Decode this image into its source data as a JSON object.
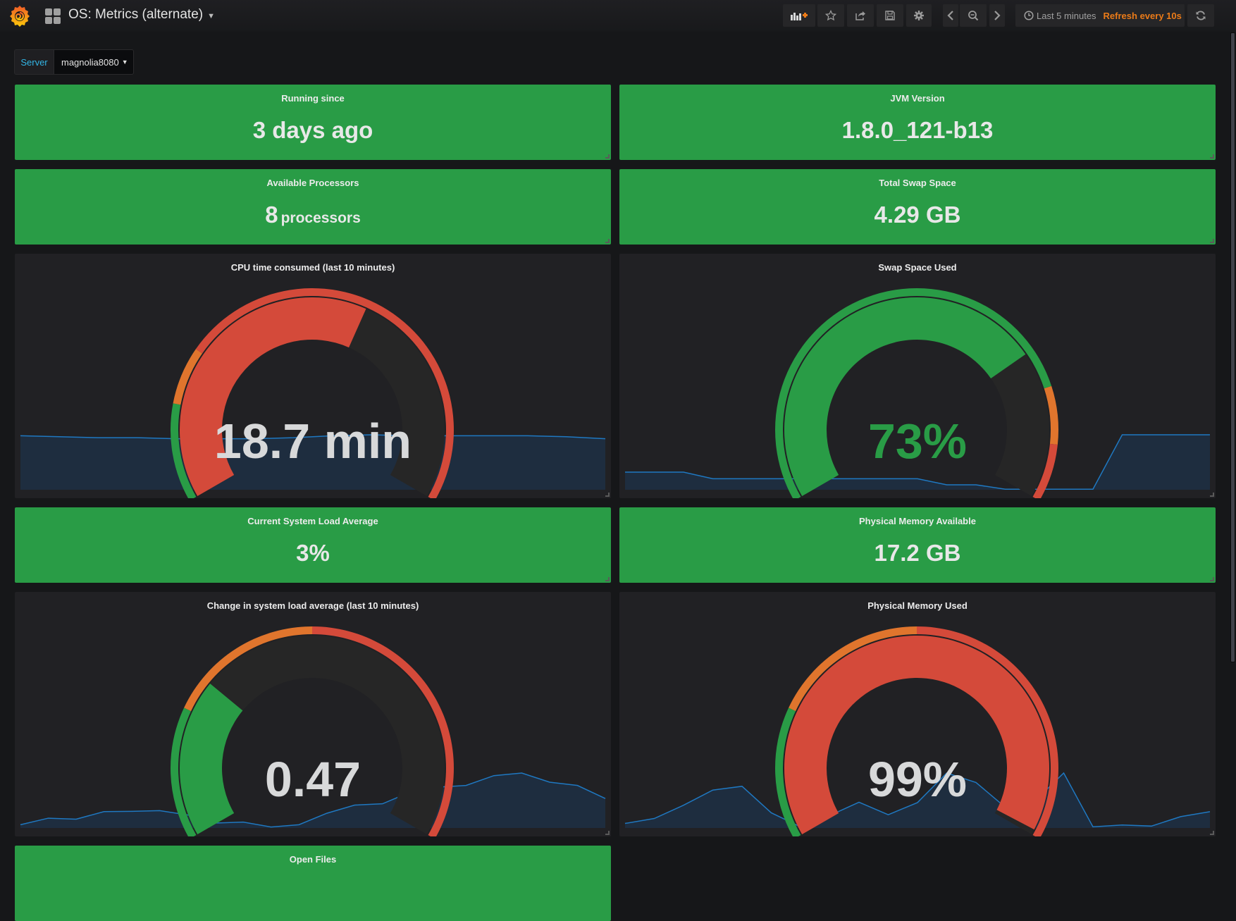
{
  "header": {
    "title": "OS: Metrics (alternate)",
    "icons": {
      "logo": "grafana-logo",
      "dashboards": "dashboard-grid-icon",
      "add_panel": "add-panel-icon",
      "star": "star-icon",
      "share": "share-icon",
      "save": "save-icon",
      "settings": "gear-icon",
      "prev": "chevron-left-icon",
      "zoom_out": "zoom-out-icon",
      "next": "chevron-right-icon",
      "clock": "clock-icon",
      "refresh": "refresh-icon"
    },
    "time_range": "Last 5 minutes",
    "refresh_label": "Refresh every 10s"
  },
  "variables": [
    {
      "label": "Server",
      "value": "magnolia8080"
    }
  ],
  "colors": {
    "ok": "#299c46",
    "warn": "#e0752d",
    "crit": "#d44a3a",
    "spark_line": "#1f78c1",
    "spark_fill": "#1e2d3f",
    "accent_orange": "#eb7b18",
    "variable_label": "#33b5e5"
  },
  "stat_panels": [
    {
      "title": "Running since",
      "value": "3 days ago",
      "unit": ""
    },
    {
      "title": "JVM Version",
      "value": "1.8.0_121-b13",
      "unit": ""
    },
    {
      "title": "Available Processors",
      "value": "8",
      "unit": "processors"
    },
    {
      "title": "Total Swap Space",
      "value": "4.29 GB",
      "unit": ""
    },
    {
      "title": "Current System Load Average",
      "value": "3%",
      "unit": ""
    },
    {
      "title": "Physical Memory Available",
      "value": "17.2 GB",
      "unit": ""
    },
    {
      "title": "Open Files",
      "value": "",
      "unit": ""
    }
  ],
  "gauge_panels": [
    {
      "title": "CPU time consumed (last 10 minutes)",
      "value": "18.7 min",
      "value_color": "#d8d9da",
      "fill_fraction": 0.6,
      "fill_color": "#d44a3a",
      "thresholds": [
        {
          "to": 0.17,
          "color": "#299c46"
        },
        {
          "to": 0.27,
          "color": "#e0752d"
        },
        {
          "to": 1.0,
          "color": "#d44a3a"
        }
      ],
      "sparkline": [
        0.55,
        0.54,
        0.53,
        0.53,
        0.52,
        0.52,
        0.52,
        0.53,
        0.55,
        0.56,
        0.55,
        0.55,
        0.55,
        0.55,
        0.54,
        0.52
      ]
    },
    {
      "title": "Swap Space Used",
      "value": "73%",
      "value_color": "#299c46",
      "fill_fraction": 0.73,
      "fill_color": "#299c46",
      "thresholds": [
        {
          "to": 0.8,
          "color": "#299c46"
        },
        {
          "to": 0.9,
          "color": "#e0752d"
        },
        {
          "to": 1.0,
          "color": "#d44a3a"
        }
      ],
      "sparkline": [
        0.32,
        0.32,
        0.32,
        0.2,
        0.2,
        0.2,
        0.2,
        0.2,
        0.2,
        0.2,
        0.2,
        0.09,
        0.09,
        0.01,
        0.01,
        0.01,
        0.01,
        1.0,
        1.0,
        1.0,
        1.0
      ]
    },
    {
      "title": "Change in system load average (last 10 minutes)",
      "value": "0.47",
      "value_color": "#d8d9da",
      "fill_fraction": 0.29,
      "fill_color": "#299c46",
      "thresholds": [
        {
          "to": 0.23,
          "color": "#299c46"
        },
        {
          "to": 0.5,
          "color": "#e0752d"
        },
        {
          "to": 1.0,
          "color": "#d44a3a"
        }
      ],
      "sparkline": [
        0.1,
        0.3,
        0.27,
        0.5,
        0.51,
        0.53,
        0.4,
        0.15,
        0.18,
        0.03,
        0.1,
        0.45,
        0.7,
        0.74,
        1.1,
        1.25,
        1.3,
        1.6,
        1.68,
        1.4,
        1.3,
        0.9
      ]
    },
    {
      "title": "Physical Memory Used",
      "value": "99%",
      "value_color": "#d8d9da",
      "fill_fraction": 0.99,
      "fill_color": "#d44a3a",
      "thresholds": [
        {
          "to": 0.23,
          "color": "#299c46"
        },
        {
          "to": 0.5,
          "color": "#e0752d"
        },
        {
          "to": 1.0,
          "color": "#d44a3a"
        }
      ],
      "sparkline": [
        0.12,
        0.25,
        0.6,
        1.0,
        1.1,
        0.4,
        0.03,
        0.33,
        0.68,
        0.35,
        0.67,
        1.45,
        1.2,
        0.55,
        0.7,
        1.45,
        0.03,
        0.08,
        0.05,
        0.3,
        0.43
      ]
    }
  ]
}
